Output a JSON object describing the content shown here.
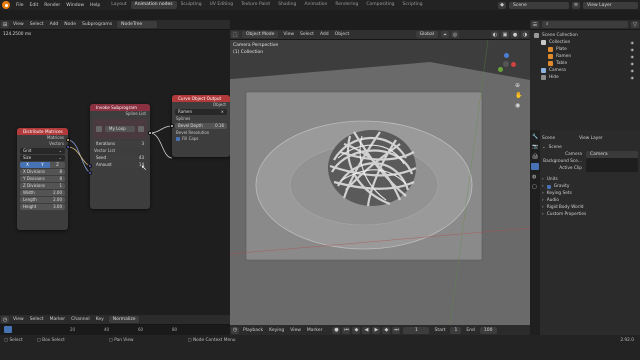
{
  "topbar": {
    "menus": [
      "File",
      "Edit",
      "Render",
      "Window",
      "Help"
    ],
    "workspaces": [
      "Layout",
      "Animation nodes",
      "Sculpting",
      "UV Editing",
      "Texture Paint",
      "Shading",
      "Animation",
      "Rendering",
      "Compositing",
      "Scripting"
    ],
    "active_workspace": "Animation nodes",
    "scene": "Scene",
    "view_layer": "View Layer"
  },
  "node_editor": {
    "header": [
      "View",
      "Select",
      "Add",
      "Node",
      "Subprograms"
    ],
    "tree_name": "NodeTree",
    "timing": "124.2500 ms",
    "footer": [
      "View",
      "Select",
      "Marker",
      "Channel",
      "Key"
    ],
    "normalize": "Normalize"
  },
  "nodes": {
    "distribute": {
      "title": "Distribute Matrices",
      "out_matrices": "Matrices",
      "out_vectors": "Vectors",
      "mode": "Grid",
      "size": "Size",
      "axes": [
        "X",
        "Y",
        "Z"
      ],
      "fields": [
        {
          "label": "X Divisions",
          "value": "8"
        },
        {
          "label": "Y Divisions",
          "value": "8"
        },
        {
          "label": "Z Divisions",
          "value": "1"
        },
        {
          "label": "Width",
          "value": "2.00"
        },
        {
          "label": "Length",
          "value": "2.00"
        },
        {
          "label": "Height",
          "value": "3.00"
        }
      ]
    },
    "invoke": {
      "title": "Invoke Subprogram",
      "out_spline": "Spline List",
      "loop_name": "My Loop",
      "iterations_label": "Iterations",
      "iterations": "3",
      "vector_list": "Vector List",
      "seed_label": "Seed",
      "seed": "43",
      "amount_label": "Amount",
      "amount": "14"
    },
    "curve_output": {
      "title": "Curve Object Output",
      "object_out": "Object",
      "object": "Ramen",
      "splines": "Splines",
      "bevel_depth_label": "Bevel Depth",
      "bevel_depth": "0.16",
      "bevel_resolution": "Bevel Resolution",
      "fill_caps": "Fill Caps"
    }
  },
  "viewport": {
    "mode": "Object Mode",
    "menus": [
      "View",
      "Select",
      "Add",
      "Object"
    ],
    "transform": "Global",
    "camera_label": "Camera Perspective",
    "collection_label": "(1) Collection"
  },
  "timeline": {
    "playback": "Playback",
    "keying": "Keying",
    "view": "View",
    "marker": "Marker",
    "current_frame": "1",
    "start_label": "Start",
    "start": "1",
    "end_label": "End",
    "end": "100",
    "ruler": [
      "0",
      "20",
      "40",
      "60",
      "80",
      "100"
    ]
  },
  "outliner": {
    "title": "Scene Collection",
    "items": [
      {
        "name": "Collection",
        "depth": 1,
        "color": "#c9c9c9"
      },
      {
        "name": "Plate",
        "depth": 2,
        "color": "#e08a2c"
      },
      {
        "name": "Ramen",
        "depth": 2,
        "color": "#e08a2c"
      },
      {
        "name": "Table",
        "depth": 2,
        "color": "#e08a2c"
      },
      {
        "name": "Camera",
        "depth": 1,
        "color": "#8cb3e0"
      },
      {
        "name": "Hide",
        "depth": 1,
        "color": "#8c8c8c"
      }
    ]
  },
  "properties": {
    "scene": "Scene",
    "view_layer": "View Layer",
    "section": "Scene",
    "camera_label": "Camera",
    "camera": "Camera",
    "background_label": "Background Sce...",
    "active_clip_label": "Active Clip",
    "panels": [
      "Units",
      "Gravity",
      "Keying Sets",
      "Audio",
      "Rigid Body World",
      "Custom Properties"
    ]
  },
  "statusbar": {
    "left": [
      "Select",
      "Box Select",
      "Pan View",
      "Node Context Menu"
    ],
    "version": "2.92.0"
  },
  "colors": {
    "accent": "#4772b3",
    "node_header_red": "#b23a3a",
    "node_header_group": "#8a3040",
    "socket_matrix": "#e0c17a",
    "socket_vector": "#6363c7",
    "socket_spline": "#c7c7c7"
  }
}
